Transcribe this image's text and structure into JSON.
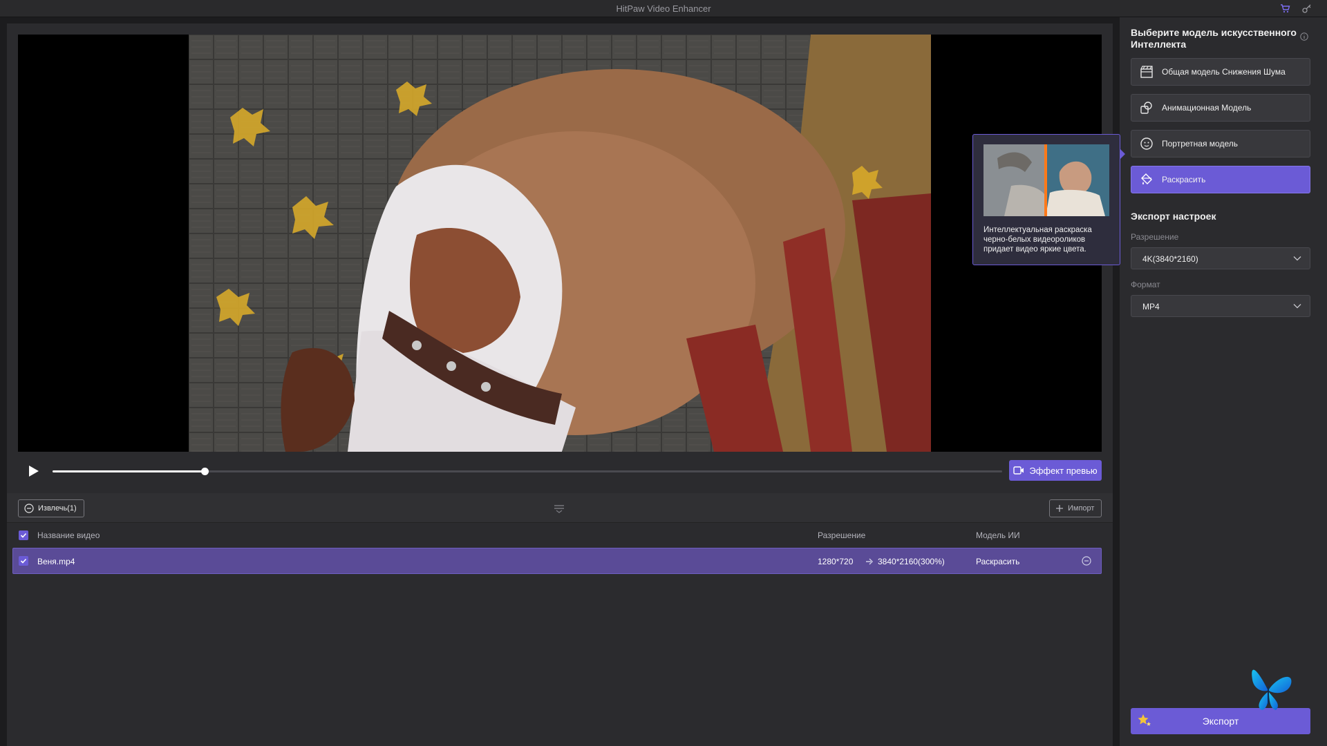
{
  "window": {
    "title": "HitPaw Video Enhancer"
  },
  "colors": {
    "accent": "#6b5bd6",
    "row_selected": "#5a4b97"
  },
  "player": {
    "progress": 0.16,
    "preview_button_label": "Эффект превью"
  },
  "list": {
    "remove_button_label": "Извлечь(1)",
    "import_button_label": "Импорт",
    "columns": {
      "name": "Название видео",
      "resolution": "Разрешение",
      "model": "Модель ИИ"
    },
    "rows": [
      {
        "name": "Веня.mp4",
        "res_from": "1280*720",
        "res_to": "3840*2160(300%)",
        "model": "Раскрасить"
      }
    ]
  },
  "sidebar": {
    "title": "Выберите модель искусственного Интеллекта",
    "models": [
      {
        "label": "Общая модель Снижения Шума",
        "icon": "clapperboard-icon"
      },
      {
        "label": "Анимационная Модель",
        "icon": "animation-icon"
      },
      {
        "label": "Портретная модель",
        "icon": "face-icon"
      },
      {
        "label": "Раскрасить",
        "icon": "paint-bucket-icon",
        "active": true
      }
    ],
    "export_settings_title": "Экспорт настроек",
    "resolution_label": "Разрешение",
    "resolution_value": "4K(3840*2160)",
    "format_label": "Формат",
    "format_value": "MP4",
    "export_button_label": "Экспорт"
  },
  "tooltip": {
    "text": "Интеллектуальная раскраска черно-белых видеороликов придает видео яркие цвета."
  }
}
